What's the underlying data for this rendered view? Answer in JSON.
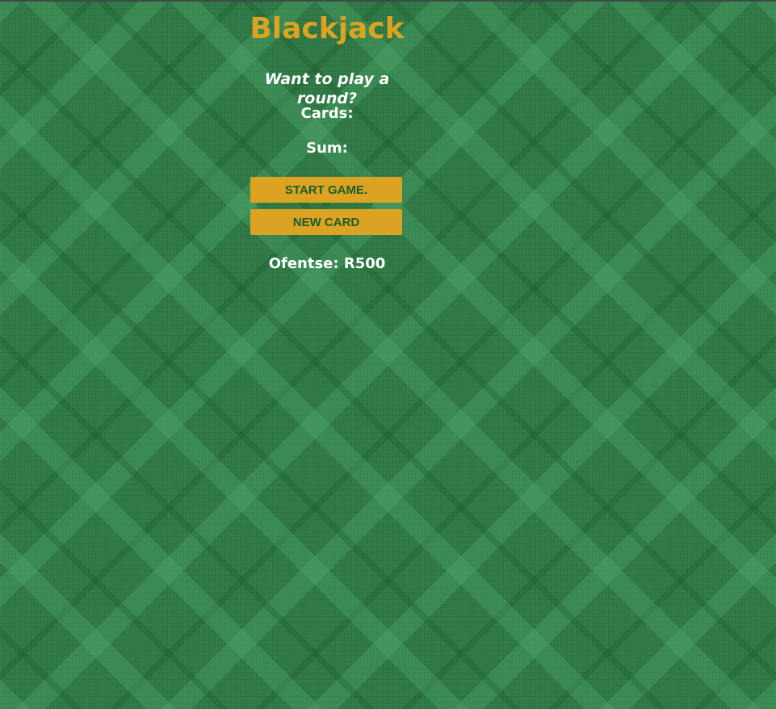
{
  "header": {
    "title": "Blackjack",
    "message": "Want to play a round?"
  },
  "game": {
    "cards_label": "Cards:",
    "sum_label": "Sum:"
  },
  "controls": {
    "start_label": "START GAME.",
    "new_card_label": "NEW CARD"
  },
  "player": {
    "text": "Ofentse: R500"
  },
  "colors": {
    "accent": "#dba321",
    "button_text": "#1a5e2c",
    "felt": "#2f7a45",
    "text": "#ffffff"
  }
}
